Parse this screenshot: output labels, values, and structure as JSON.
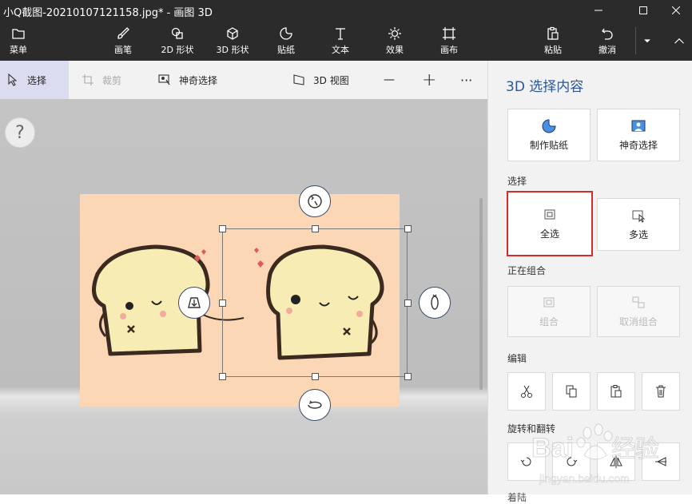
{
  "window": {
    "title": "小Q截图-20210107121158.jpg* - 画图 3D"
  },
  "ribbon": {
    "menu": "菜单",
    "brushes": "画笔",
    "shapes2d": "2D 形状",
    "shapes3d": "3D 形状",
    "stickers": "贴纸",
    "text": "文本",
    "effects": "效果",
    "canvas": "画布",
    "paste": "粘贴",
    "undo": "撤消"
  },
  "toolbar": {
    "select": "选择",
    "crop": "裁剪",
    "magic_select": "神奇选择",
    "view3d": "3D 视图",
    "zoom_out": "—",
    "zoom_in": "+",
    "more": "···"
  },
  "canvas": {
    "help": "?"
  },
  "panel": {
    "title": "3D 选择内容",
    "make_sticker": "制作贴纸",
    "magic_select": "神奇选择",
    "section_select": "选择",
    "select_all": "全选",
    "multi_select": "多选",
    "section_group": "正在组合",
    "group": "组合",
    "ungroup": "取消组合",
    "section_edit": "编辑",
    "section_rotate": "旋转和翻转",
    "section_more": "着陆"
  },
  "watermark": {
    "text": "Bai 经验",
    "sub": "jingyan.baidu.com"
  },
  "colors": {
    "accent": "#2b579a",
    "chrome": "#2b2b2b",
    "highlight": "#d42c2c",
    "image_bg": "#fcd7b5"
  }
}
